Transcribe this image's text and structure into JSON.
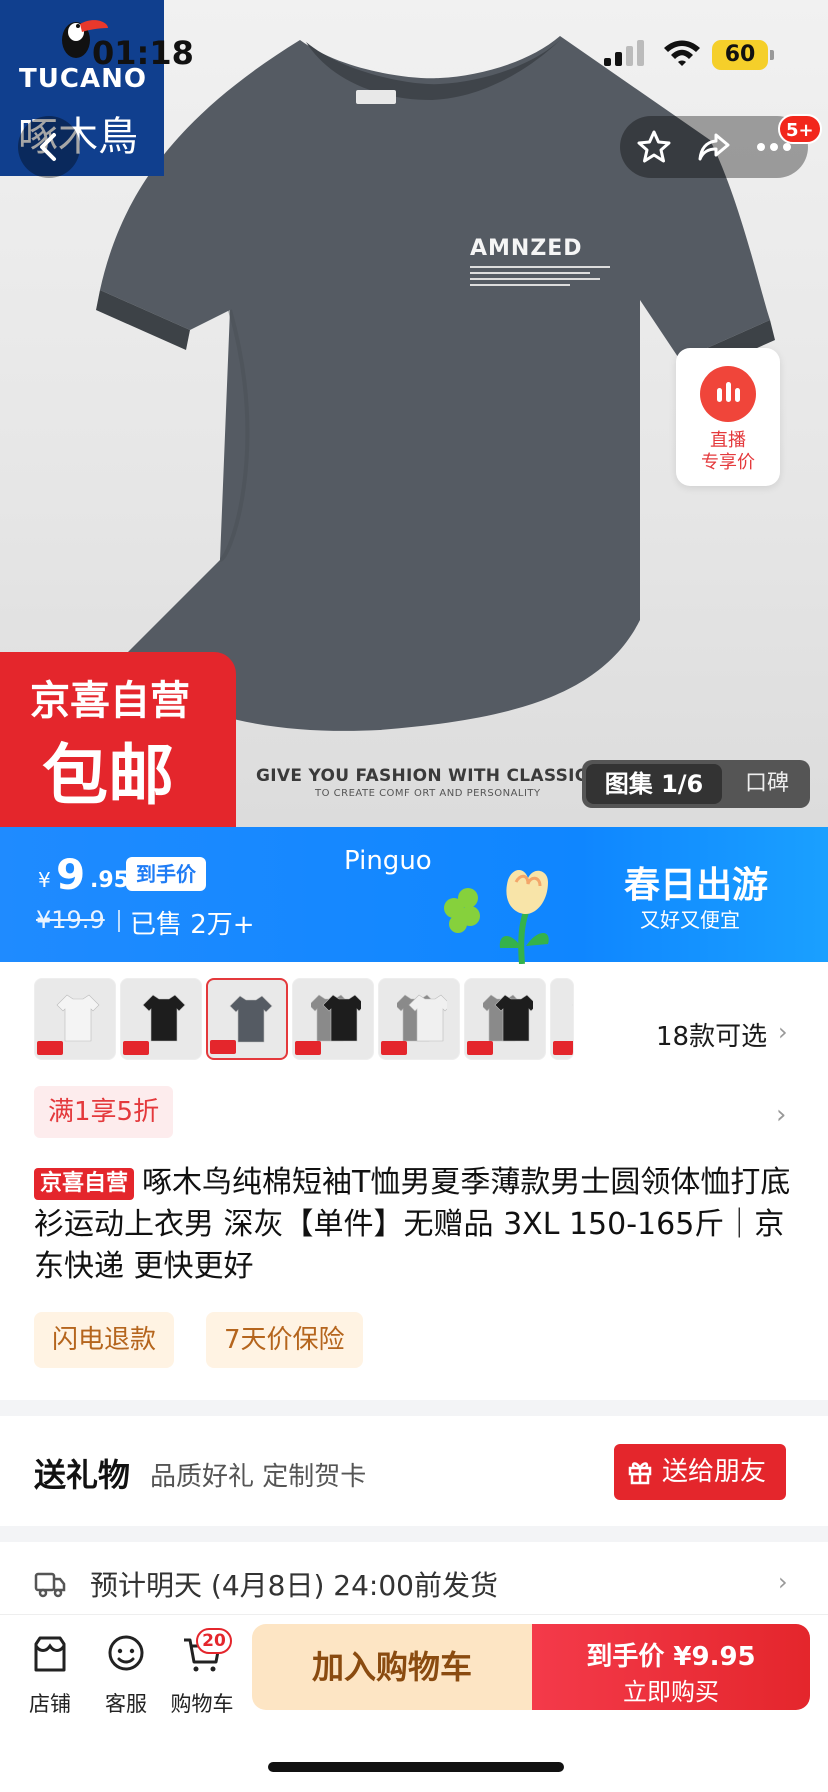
{
  "status": {
    "time": "01:18",
    "battery": "60"
  },
  "brand": {
    "latin": "TUCANO",
    "cn": "啄木鳥"
  },
  "header": {
    "cart_badge": "5+"
  },
  "product_image": {
    "shirt_brand": "AMNZED",
    "slogan": "GIVE YOU FASHION WITH CLASSIC STYLE",
    "slogan_sub": "TO CREATE COMF ORT AND PERSONALITY",
    "badge_title": "京喜自营",
    "badge_free": "包邮",
    "gallery_tab": "图集 1/6",
    "reviews_tab": "口碑"
  },
  "live": {
    "label": "直播\n专享价"
  },
  "banner": {
    "currency": "¥",
    "price_int": "9",
    "price_dec": ".95",
    "price_tag": "到手价",
    "original_price": "¥19.9",
    "sold": "已售 2万+",
    "center_text": "Pinguo",
    "campaign_title": "春日出游",
    "campaign_sub": "又好又便宜"
  },
  "variants": {
    "count_label": "18款可选",
    "thumbs": [
      "white",
      "black",
      "darkgray",
      "gray-black",
      "gray-white",
      "gray-black",
      "more"
    ],
    "selected_index": 2
  },
  "promo": {
    "label": "满1享5折"
  },
  "title": {
    "badge": "京喜自营",
    "text": "啄木鸟纯棉短袖T恤男夏季薄款男士圆领体恤打底衫运动上衣男 深灰【单件】无赠品 3XL 150-165斤｜京东快递 更快更好"
  },
  "services": [
    "闪电退款",
    "7天价保险"
  ],
  "gift": {
    "title": "送礼物",
    "subtitle": "品质好礼 定制贺卡",
    "button": "送给朋友"
  },
  "shipping": {
    "text": "预计明天 (4月8日) 24:00前发货"
  },
  "bottom": {
    "store": "店铺",
    "service": "客服",
    "cart": "购物车",
    "cart_count": "20",
    "add_cart": "加入购物车",
    "buy_price": "到手价 ¥9.95",
    "buy_label": "立即购买"
  },
  "colors": {
    "accent_red": "#e4262c",
    "banner_blue": "#1f8bff",
    "cart_bg": "#fde5c4"
  },
  "icons": [
    "back-icon",
    "star-icon",
    "share-icon",
    "more-icon",
    "live-icon",
    "gift-icon",
    "truck-icon",
    "store-icon",
    "service-icon",
    "cart-icon"
  ]
}
